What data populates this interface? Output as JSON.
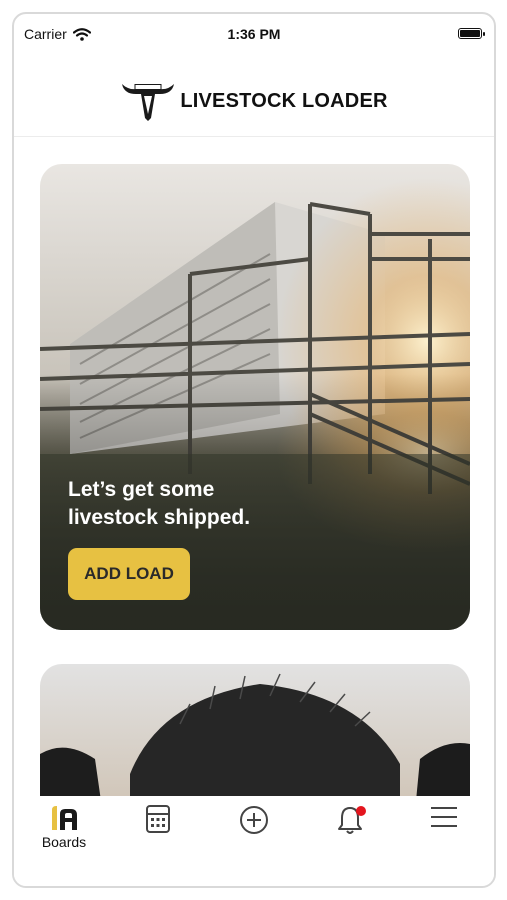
{
  "status_bar": {
    "carrier": "Carrier",
    "time": "1:36 PM"
  },
  "header": {
    "app_name": "LIVESTOCK LOADER",
    "logo_icon": "bull-horns-icon"
  },
  "hero_card": {
    "headline_line1": "Let’s get some",
    "headline_line2": "livestock shipped.",
    "button_label": "ADD LOAD",
    "button_color": "#e7c142"
  },
  "second_card": {
    "image": "black-cattle-photo"
  },
  "tab_bar": {
    "tabs": [
      {
        "label": "Boards",
        "icon": "boards-icon",
        "active": true
      },
      {
        "label": "",
        "icon": "calculator-icon"
      },
      {
        "label": "",
        "icon": "plus-circle-icon"
      },
      {
        "label": "",
        "icon": "bell-icon"
      },
      {
        "label": "",
        "icon": "menu-icon"
      }
    ],
    "notification_color": "#e4151e"
  }
}
